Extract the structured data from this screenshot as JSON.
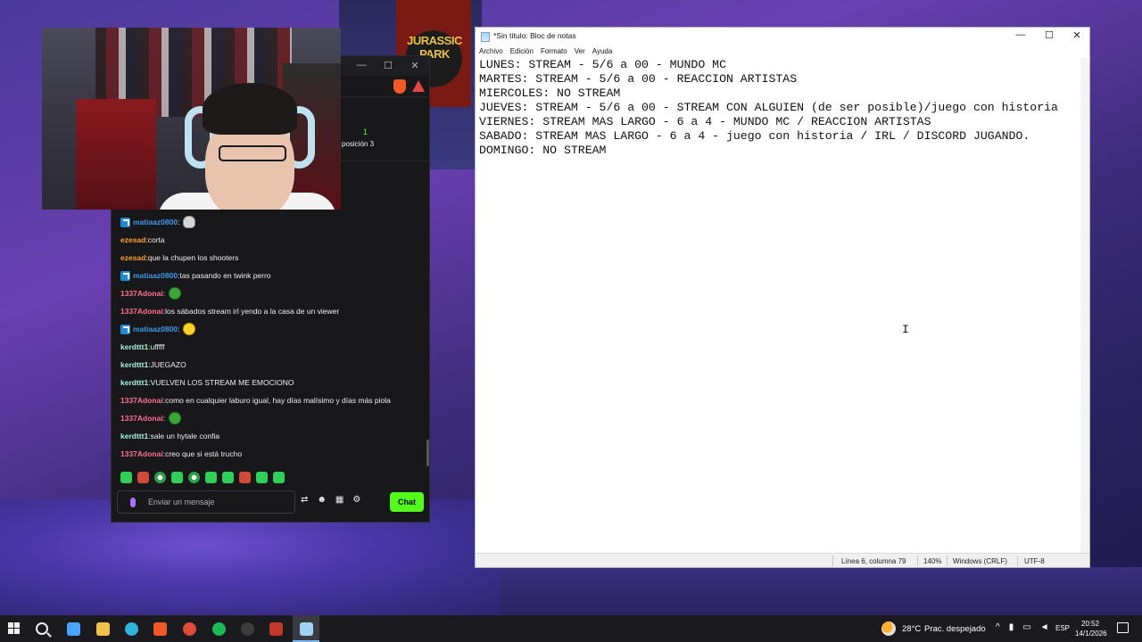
{
  "background": {
    "poster_title": "JURASSIC PARK"
  },
  "chat": {
    "viewer_count": "1",
    "position_text": "posición 3",
    "messages": [
      {
        "user": "matiaaz0800",
        "user_color": "#3e9ae6",
        "badge": true,
        "text": "",
        "emote": "skull"
      },
      {
        "user": "ezesad",
        "user_color": "#ff9f35",
        "badge": false,
        "text": "corta",
        "emote": ""
      },
      {
        "user": "ezesad",
        "user_color": "#ff9f35",
        "badge": false,
        "text": "que la chupen los shooters",
        "emote": ""
      },
      {
        "user": "matiaaz0800",
        "user_color": "#3e9ae6",
        "badge": true,
        "text": "tas pasando en twink perro",
        "emote": ""
      },
      {
        "user": "1337Adonai",
        "user_color": "#ff6f91",
        "badge": false,
        "text": "",
        "emote": "pepe"
      },
      {
        "user": "1337Adonai",
        "user_color": "#ff6f91",
        "badge": false,
        "text": "los sábados stream irl yendo a la casa de un viewer",
        "emote": ""
      },
      {
        "user": "matiaaz0800",
        "user_color": "#3e9ae6",
        "badge": true,
        "text": "",
        "emote": "yellow"
      },
      {
        "user": "kerdttt1",
        "user_color": "#a8f0e0",
        "badge": false,
        "text": "ufffff",
        "emote": ""
      },
      {
        "user": "kerdttt1",
        "user_color": "#a8f0e0",
        "badge": false,
        "text": "JUEGAZO",
        "emote": ""
      },
      {
        "user": "kerdttt1",
        "user_color": "#a8f0e0",
        "badge": false,
        "text": "VUELVEN LOS STREAM ME EMOCIONO",
        "emote": ""
      },
      {
        "user": "1337Adonai",
        "user_color": "#ff6f91",
        "badge": false,
        "text": "como en cualquier laburo igual, hay días malísimo y días más piola",
        "emote": ""
      },
      {
        "user": "1337Adonai",
        "user_color": "#ff6f91",
        "badge": false,
        "text": "",
        "emote": "pepe"
      },
      {
        "user": "kerdttt1",
        "user_color": "#a8f0e0",
        "badge": false,
        "text": "sale un hytale confia",
        "emote": ""
      },
      {
        "user": "1337Adonai",
        "user_color": "#ff6f91",
        "badge": false,
        "text": "creo que si está trucho",
        "emote": ""
      }
    ],
    "input_placeholder": "Enviar un mensaje",
    "send_label": "Chat",
    "accent_color": "#53fc18"
  },
  "notepad": {
    "title": "*Sin título: Bloc de notas",
    "menu": [
      "Archivo",
      "Edición",
      "Formato",
      "Ver",
      "Ayuda"
    ],
    "content": "LUNES: STREAM - 5/6 a 00 - MUNDO MC\nMARTES: STREAM - 5/6 a 00 - REACCION ARTISTAS\nMIERCOLES: NO STREAM\nJUEVES: STREAM - 5/6 a 00 - STREAM CON ALGUIEN (de ser posible)/juego con historia\nVIERNES: STREAM MAS LARGO - 6 a 4 - MUNDO MC / REACCION ARTISTAS\nSABADO: STREAM MAS LARGO - 6 a 4 - juego con historia / IRL / DISCORD JUGANDO.\nDOMINGO: NO STREAM",
    "status": {
      "position": "Línea 6, columna 79",
      "zoom": "140%",
      "line_ending": "Windows (CRLF)",
      "encoding": "UTF-8"
    }
  },
  "taskbar": {
    "apps": [
      "copilot-icon",
      "file-explorer-icon",
      "edge-icon",
      "brave-icon",
      "chrome-icon",
      "spotify-icon",
      "obs-icon",
      "video-editor-icon",
      "notepad-icon"
    ],
    "weather_temp": "28°C",
    "weather_text": "Prac. despejado",
    "language": "ESP",
    "time": "20:52",
    "date": "14/1/2026"
  }
}
